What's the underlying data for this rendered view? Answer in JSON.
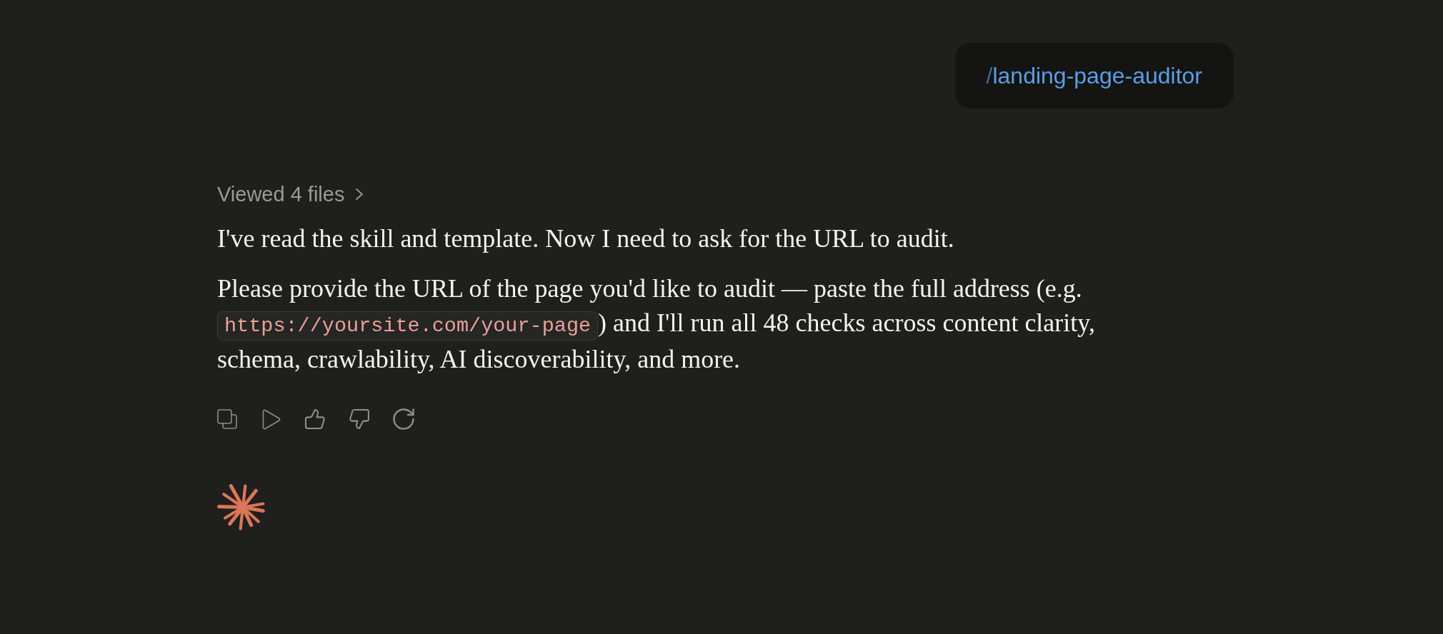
{
  "user_message": {
    "command_prefix": "/",
    "command": "landing-page-auditor"
  },
  "assistant_message": {
    "activity": {
      "label": "Viewed 4 files",
      "expanded": false
    },
    "paragraphs": [
      {
        "segments": [
          {
            "kind": "text",
            "text": "I've read the skill and template. Now I need to ask for the URL to audit."
          }
        ]
      },
      {
        "segments": [
          {
            "kind": "text",
            "text": "Please provide the URL of the page you'd like to audit — paste the full address (e.g. "
          },
          {
            "kind": "code",
            "text": "https://yoursite.com/your-page"
          },
          {
            "kind": "text",
            "text": ") and I'll run all 48 checks across content clarity, schema, crawlability, AI discoverability, and more."
          }
        ]
      }
    ]
  }
}
